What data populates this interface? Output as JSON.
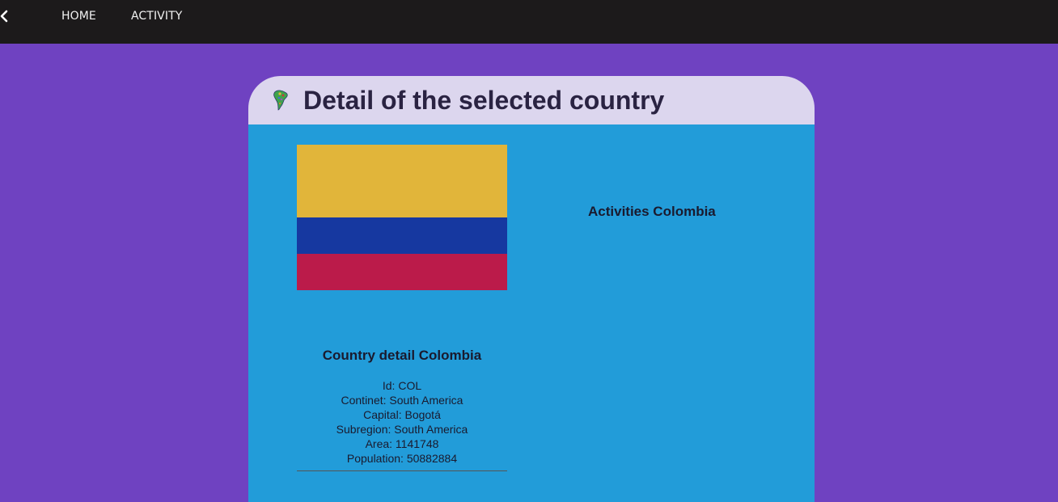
{
  "nav": {
    "home_label": "HOME",
    "activity_label": "ACTIVITY",
    "back_icon": "chevron-left-icon"
  },
  "colors": {
    "page_background": "#6f42c1",
    "navbar_background": "#1c1a1b",
    "header_background": "#dcd6ee",
    "body_background": "#229cd9",
    "flag_yellow": "#e1b53a",
    "flag_blue": "#1638a0",
    "flag_red": "#bb1b4a"
  },
  "card": {
    "title": "Detail of the selected country",
    "title_icon": "south-america-map-icon"
  },
  "country": {
    "flag_icon": "colombia-flag",
    "detail_title": "Country detail Colombia",
    "details": [
      "Id: COL",
      "Continet: South America",
      "Capital: Bogotá",
      "Subregion: South America",
      "Area: 1141748",
      "Population: 50882884"
    ]
  },
  "activities": {
    "title": "Activities Colombia"
  }
}
